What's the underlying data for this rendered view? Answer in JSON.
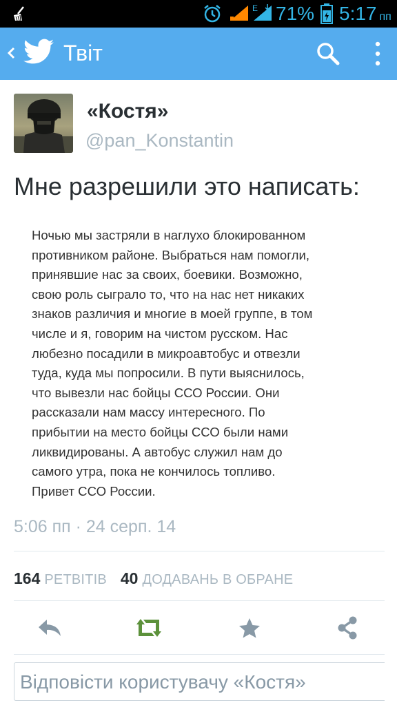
{
  "status_bar": {
    "battery_percent": "71%",
    "time": "5:17",
    "time_suffix": "пп",
    "network_label": "E",
    "icons": [
      "broom-icon",
      "alarm-icon",
      "signal-icon",
      "signal-e-icon",
      "battery-icon"
    ]
  },
  "action_bar": {
    "title": "Твіт",
    "icons": [
      "back-chevron-icon",
      "twitter-bird-icon",
      "search-icon",
      "overflow-menu-icon"
    ]
  },
  "tweet": {
    "display_name": "«Костя»",
    "handle": "@pan_Konstantin",
    "text": "Мне разрешили это написать:",
    "embedded_text": "Ночью мы застряли в наглухо блокированном\nпротивником районе. Выбраться нам помогли,\nпринявшие нас за своих, боевики. Возможно,\nсвою роль сыграло то, что на нас нет никаких\nзнаков различия и многие в моей группе, в том\nчисле и я, говорим на чистом русском. Нас\nлюбезно посадили в микроавтобус и отвезли\nтуда, куда мы попросили. В пути выяснилось,\nчто вывезли нас бойцы ССО России. Они\nрассказали нам массу интересного. По\nприбытии на место бойцы ССО были нами\nликвидированы. А автобус служил нам до\nсамого утра, пока не кончилось топливо.\nПривет ССО России.",
    "timestamp": "5:06 пп · 24 серп. 14",
    "retweets_count": "164",
    "retweets_label": "РЕТВІТІВ",
    "favorites_count": "40",
    "favorites_label": "ДОДАВАНЬ В ОБРАНЕ"
  },
  "actions": {
    "icons": [
      "reply-icon",
      "retweet-icon",
      "favorite-star-icon",
      "share-icon"
    ],
    "retweet_color": "#5c913b",
    "icon_color": "#8899a6"
  },
  "reply": {
    "placeholder": "Відповісти користувачу «Костя»"
  },
  "colors": {
    "action_bar": "#55acee",
    "status_bar_text": "#33b5e5",
    "status_bar_bg": "#000000"
  }
}
